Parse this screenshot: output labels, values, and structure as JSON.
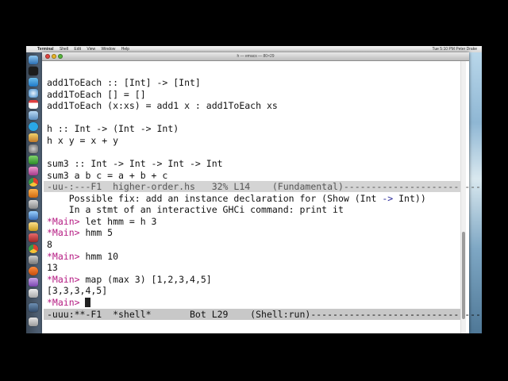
{
  "menubar": {
    "apple": "",
    "menus": [
      "Terminal",
      "Shell",
      "Edit",
      "View",
      "Window",
      "Help"
    ],
    "clock": "Tue 5:10 PM",
    "user": "Peter Drake"
  },
  "window": {
    "title": "h — emacs — 80×29"
  },
  "editor": {
    "code_lines": [
      "add1ToEach :: [Int] -> [Int]",
      "add1ToEach [] = []",
      "add1ToEach (x:xs) = add1 x : add1ToEach xs",
      "",
      "h :: Int -> (Int -> Int)",
      "h x y = x + y",
      "",
      "sum3 :: Int -> Int -> Int -> Int",
      "sum3 a b c = a + b + c"
    ],
    "top_modeline": "-uu-:---F1  higher-order.hs   32% L14    (Fundamental)------------------------------",
    "shell": {
      "error_line1_pre": "    Possible fix: add an instance declaration for (Show (Int ",
      "error_arrow": "->",
      "error_line1_post": " Int))",
      "error_line2": "    In a stmt of an interactive GHCi command: print it",
      "prompt": "*Main>",
      "cmd1": " let hmm = h 3",
      "cmd2": " hmm 5",
      "out2": "8",
      "cmd3": " hmm 10",
      "out3": "13",
      "cmd4": " map (max 3) [1,2,3,4,5]",
      "out4": "[3,3,3,4,5]",
      "cmd5": " "
    },
    "bottom_modeline": "-uuu:**-F1  *shell*       Bot L29    (Shell:run)-----------------------------------"
  },
  "colors": {
    "prompt": "#b51a82",
    "modeline_bg": "#c8c8c8",
    "desktop": "#5b8fb0"
  }
}
